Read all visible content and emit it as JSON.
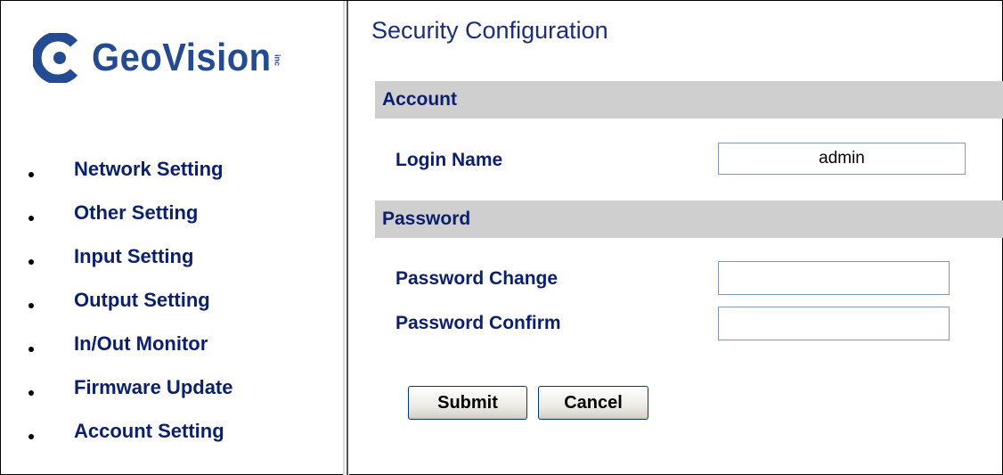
{
  "brand": {
    "name": "GeoVision",
    "suffix": "inc",
    "color": "#244a92",
    "icon": "geovision-logo-icon"
  },
  "sidebar": {
    "items": [
      {
        "label": "Network Setting"
      },
      {
        "label": "Other Setting"
      },
      {
        "label": "Input Setting"
      },
      {
        "label": "Output Setting"
      },
      {
        "label": "In/Out Monitor"
      },
      {
        "label": "Firmware Update"
      },
      {
        "label": "Account Setting"
      }
    ]
  },
  "main": {
    "title": "Security Configuration",
    "account_section": {
      "heading": "Account",
      "login_name_label": "Login Name",
      "login_name_value": "admin"
    },
    "password_section": {
      "heading": "Password",
      "change_label": "Password Change",
      "change_value": "",
      "confirm_label": "Password Confirm",
      "confirm_value": ""
    },
    "buttons": {
      "submit": "Submit",
      "cancel": "Cancel"
    }
  },
  "colors": {
    "link_text": "#0a1f6e",
    "title_text": "#1a2e7d",
    "section_bar": "#cfcfcf"
  }
}
